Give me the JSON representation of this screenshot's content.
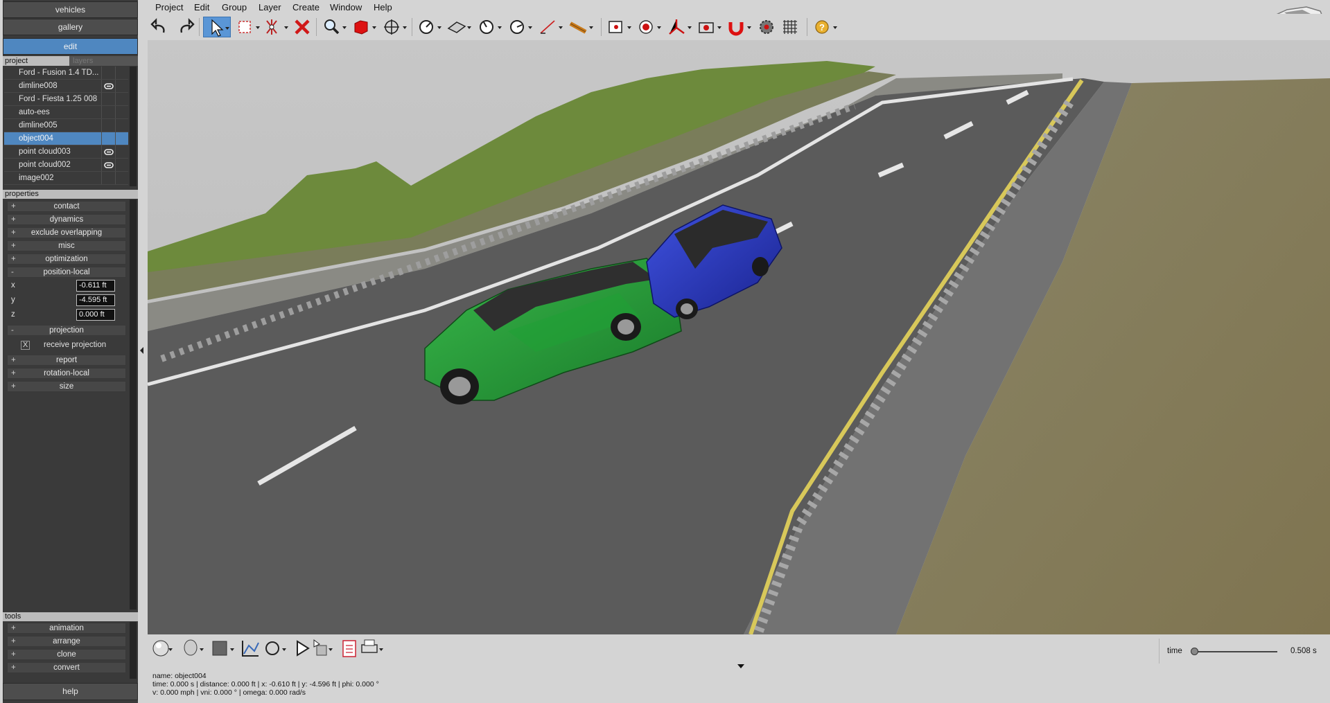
{
  "left_panel": {
    "buttons": {
      "vehicles": "vehicles",
      "gallery": "gallery",
      "edit": "edit",
      "help": "help"
    },
    "tabs": {
      "project": "project",
      "layers": "layers"
    },
    "project_items": [
      {
        "label": "Ford - Fusion 1.4 TD...",
        "linked": false,
        "selected": false
      },
      {
        "label": "dimline008",
        "linked": true,
        "selected": false
      },
      {
        "label": "Ford - Fiesta 1.25 008",
        "linked": false,
        "selected": false
      },
      {
        "label": "auto-ees",
        "linked": false,
        "selected": false
      },
      {
        "label": "dimline005",
        "linked": false,
        "selected": false
      },
      {
        "label": "object004",
        "linked": false,
        "selected": true
      },
      {
        "label": "point cloud003",
        "linked": true,
        "selected": false
      },
      {
        "label": "point cloud002",
        "linked": true,
        "selected": false
      },
      {
        "label": "image002",
        "linked": false,
        "selected": false
      }
    ],
    "properties_header": "properties",
    "properties": {
      "contact": "contact",
      "dynamics": "dynamics",
      "exclude_overlapping": "exclude overlapping",
      "misc": "misc",
      "optimization": "optimization",
      "position_local": "position-local",
      "x_label": "x",
      "x_value": "-0.611 ft",
      "y_label": "y",
      "y_value": "-4.595 ft",
      "z_label": "z",
      "z_value": "0.000 ft",
      "projection": "projection",
      "receive_projection": "receive projection",
      "receive_projection_checked": "X",
      "report": "report",
      "rotation_local": "rotation-local",
      "size": "size"
    },
    "tools_header": "tools",
    "tools": {
      "animation": "animation",
      "arrange": "arrange",
      "clone": "clone",
      "convert": "convert"
    },
    "plus": "+",
    "minus": "-"
  },
  "menu": {
    "project": "Project",
    "edit": "Edit",
    "group": "Group",
    "layer": "Layer",
    "create": "Create",
    "window": "Window",
    "help": "Help"
  },
  "status": {
    "line1": "name: object004",
    "line2": "time: 0.000 s | distance: 0.000 ft | x: -0.610 ft | y: -4.596 ft | phi: 0.000 °",
    "line3": "v: 0.000 mph | vni: 0.000 ° | omega: 0.000 rad/s"
  },
  "time": {
    "label": "time",
    "value": "0.508 s",
    "slider_fraction": 0.0
  },
  "colors": {
    "accent": "#4f87c0",
    "car_green": "#2a9a3a",
    "car_blue": "#2d3fc9",
    "road_yellow": "#d8c85a"
  }
}
